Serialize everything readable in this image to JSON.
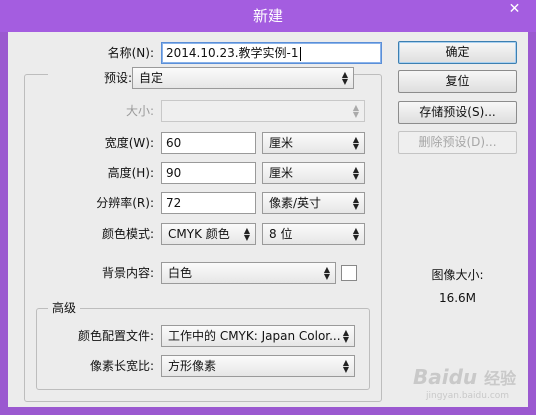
{
  "window": {
    "title": "新建",
    "close_glyph": "✕"
  },
  "form": {
    "name": {
      "label": "名称(N):",
      "value": "2014.10.23.教学实例-1"
    },
    "preset": {
      "label": "预设:",
      "value": "自定"
    },
    "size": {
      "label": "大小:",
      "value": ""
    },
    "width": {
      "label": "宽度(W):",
      "value": "60",
      "unit": "厘米"
    },
    "height": {
      "label": "高度(H):",
      "value": "90",
      "unit": "厘米"
    },
    "resolution": {
      "label": "分辨率(R):",
      "value": "72",
      "unit": "像素/英寸"
    },
    "color_mode": {
      "label": "颜色模式:",
      "value": "CMYK 颜色",
      "depth": "8 位"
    },
    "background": {
      "label": "背景内容:",
      "value": "白色"
    }
  },
  "advanced": {
    "title": "高级",
    "color_profile": {
      "label": "颜色配置文件:",
      "value": "工作中的 CMYK: Japan Color..."
    },
    "pixel_aspect": {
      "label": "像素长宽比:",
      "value": "方形像素"
    }
  },
  "buttons": {
    "ok": "确定",
    "reset": "复位",
    "save_preset": "存储预设(S)...",
    "delete_preset": "删除预设(D)..."
  },
  "image_size": {
    "label": "图像大小:",
    "value": "16.6M"
  },
  "watermark": {
    "brand": "Baidu",
    "text": "经验",
    "url": "jingyan.baidu.com"
  },
  "icons": {
    "dropdown": "chevron-updown-icon"
  },
  "colors": {
    "titlebar": "#a45de0",
    "dialog": "#ececec",
    "primary_border": "#3c7fb1"
  }
}
